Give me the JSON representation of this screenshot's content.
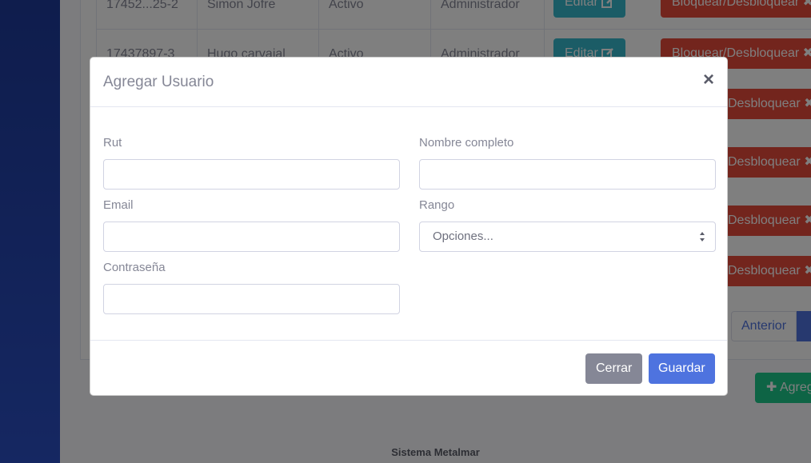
{
  "background": {
    "rows": [
      {
        "rut": "17452...25-2",
        "name": "Simon Jofre",
        "status": "Activo",
        "role": "Administrador"
      },
      {
        "rut": "17437897-3",
        "name": "Hugo carvajal",
        "status": "Activo",
        "role": "Administrador"
      }
    ],
    "edit_label": "Editar",
    "block_label": "Bloquear/Desbloquear",
    "block_label_partial": "Desbloquear",
    "pager_prev": "Anterior",
    "add_button": "Agreg",
    "footer_text": "Sistema Metalmar"
  },
  "modal": {
    "title": "Agregar Usuario",
    "close_symbol": "×",
    "fields": {
      "rut": {
        "label": "Rut",
        "value": ""
      },
      "nombre": {
        "label": "Nombre completo",
        "value": ""
      },
      "email": {
        "label": "Email",
        "value": ""
      },
      "rango": {
        "label": "Rango",
        "selected": "Opciones..."
      },
      "password": {
        "label": "Contraseña",
        "value": ""
      }
    },
    "cancel_label": "Cerrar",
    "save_label": "Guardar"
  },
  "colors": {
    "primary": "#4e73df",
    "secondary": "#858796",
    "danger": "#e74a3b",
    "info": "#36b9cc",
    "success": "#1cc88a"
  }
}
